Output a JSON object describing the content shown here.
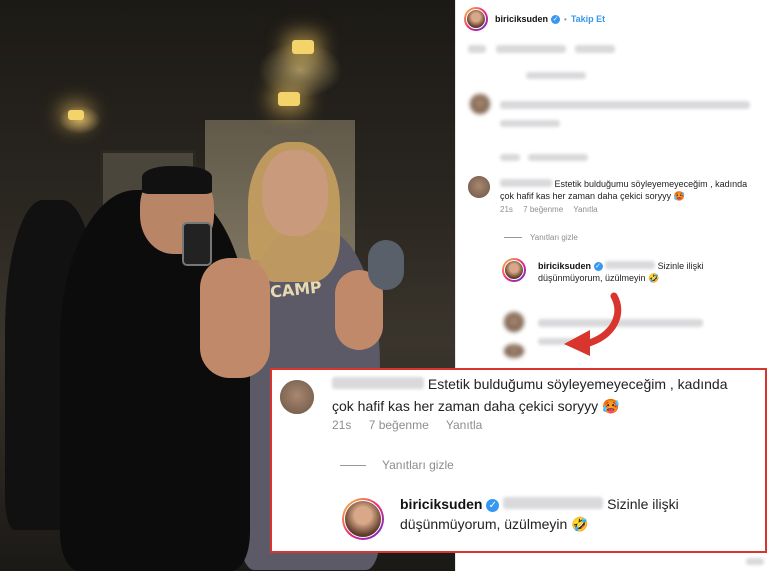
{
  "post": {
    "username": "biriciksuden",
    "follow_label": "Takip Et"
  },
  "comment": {
    "text_line1": "Estetik bulduğumu söyleyemeyeceğim , kadında",
    "text_line2": "çok hafif kas her zaman daha çekici soryyy",
    "emoji": "🥵",
    "time": "21s",
    "likes": "7 beğenme",
    "reply_label": "Yanıtla",
    "hide_replies_label": "Yanıtları gizle"
  },
  "reply": {
    "username": "biriciksuden",
    "text_line1": "Sizinle ilişki",
    "text_line2": "düşünmüyorum, üzülmeyin",
    "emoji": "🤣"
  },
  "photo": {
    "shirt_text": "CAMP"
  },
  "colors": {
    "link_blue": "#3897f0",
    "callout_border": "#d8352e",
    "arrow_red": "#d8352e"
  }
}
